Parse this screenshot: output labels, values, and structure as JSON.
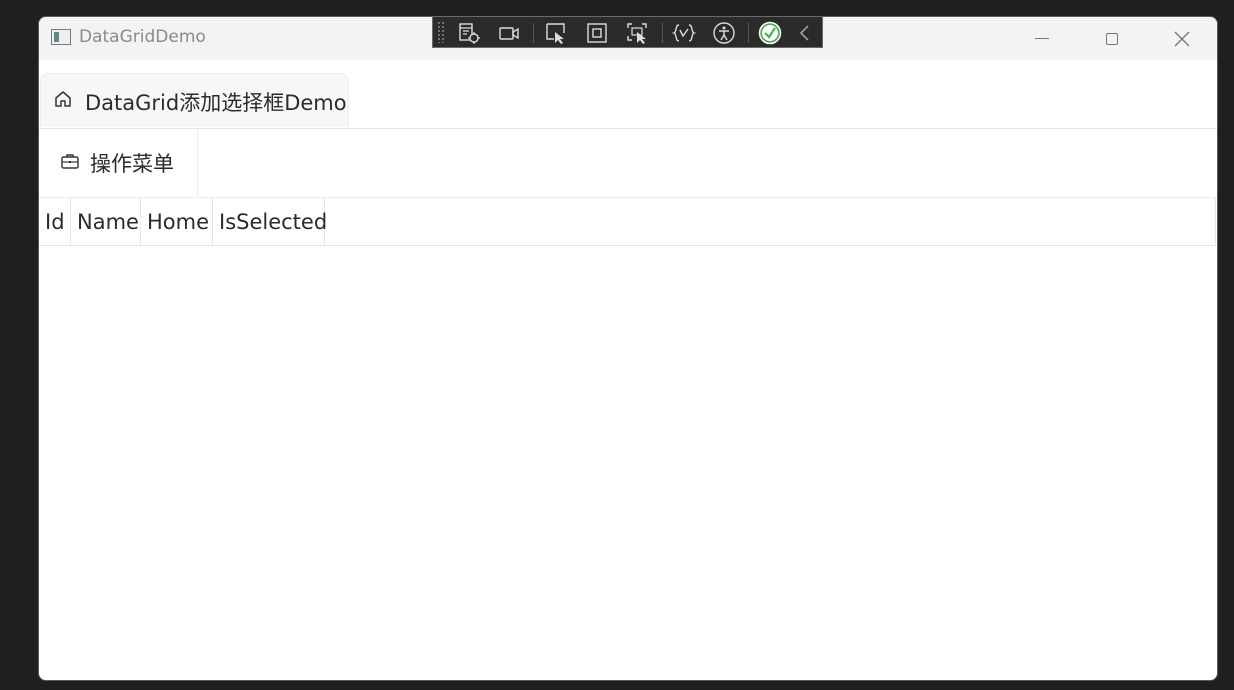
{
  "window": {
    "title": "DataGridDemo"
  },
  "debug_toolbar": {
    "tools": [
      "live-visual-tree-icon",
      "record-icon",
      "select-element-icon",
      "display-layout-adorners-icon",
      "track-focus-icon",
      "binding-failures-icon",
      "accessibility-icon",
      "validation-check-icon",
      "collapse-chevron-icon"
    ]
  },
  "tabs": [
    {
      "label": "DataGrid添加选择框Demo",
      "icon": "home-icon"
    }
  ],
  "menu": {
    "label": "操作菜单",
    "icon": "briefcase-icon"
  },
  "grid": {
    "columns": [
      "Id",
      "Name",
      "Home",
      "IsSelected"
    ],
    "rows": []
  },
  "colors": {
    "titlebar_bg": "#f2f3f5",
    "toolbar_bg": "#2b2b2b",
    "check_green": "#4caf50"
  }
}
